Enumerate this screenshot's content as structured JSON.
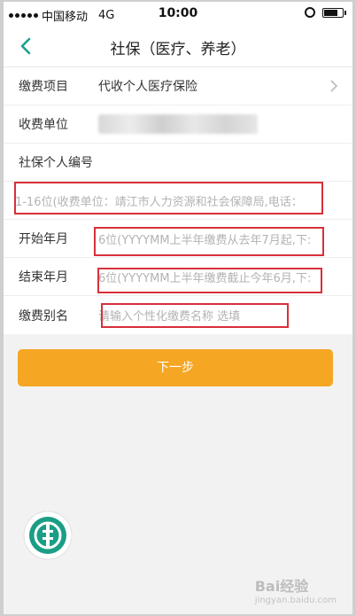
{
  "status": {
    "carrier": "中国移动",
    "network": "4G",
    "time": "10:00"
  },
  "nav": {
    "title": "社保（医疗、养老）"
  },
  "form": {
    "item": {
      "label": "缴费项目",
      "value": "代收个人医疗保险"
    },
    "unit": {
      "label": "收费单位"
    },
    "personal_no": {
      "label": "社保个人编号",
      "placeholder": "1-16位(收费单位：靖江市人力资源和社会保障局,电话："
    },
    "start": {
      "label": "开始年月",
      "placeholder": "6位(YYYYMM上半年缴费从去年7月起,下:"
    },
    "end": {
      "label": "结束年月",
      "placeholder": "6位(YYYYMM上半年缴费截止今年6月,下:"
    },
    "alias": {
      "label": "缴费别名",
      "placeholder": "请输入个性化缴费名称  选填"
    }
  },
  "next_button": {
    "label": "下一步"
  },
  "watermark": {
    "text": "Bai",
    "suffix": "经验",
    "sub": "jingyan.baidu.com"
  },
  "colors": {
    "accent": "#f5a623",
    "back_arrow": "#1aa08c",
    "logo": "#1a9e86",
    "annotation": "#d8303a"
  }
}
